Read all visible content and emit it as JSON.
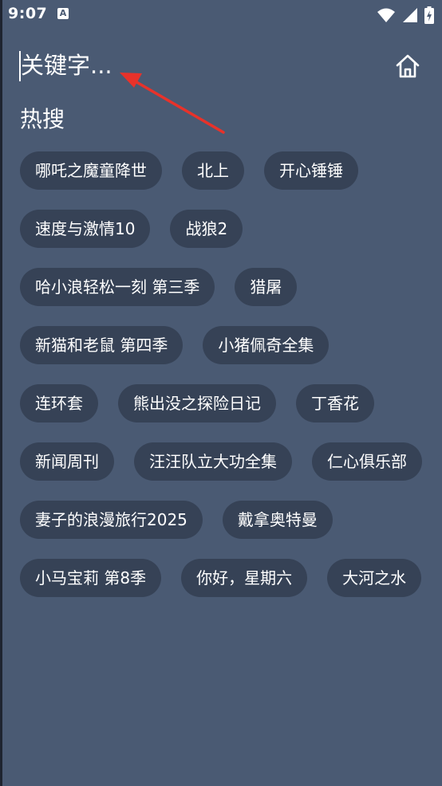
{
  "status_bar": {
    "time": "9:07",
    "notification_letter": "A",
    "icons": [
      "wifi-icon",
      "signal-icon",
      "battery-charging-icon"
    ]
  },
  "search": {
    "placeholder": "关键字...",
    "value": ""
  },
  "home_icon": "home-icon",
  "hot_search": {
    "title": "热搜",
    "items": [
      "哪吒之魔童降世",
      "北上",
      "开心锤锤",
      "速度与激情10",
      "战狼2",
      "哈小浪轻松一刻 第三季",
      "猎屠",
      "新猫和老鼠 第四季",
      "小猪佩奇全集",
      "连环套",
      "熊出没之探险日记",
      "丁香花",
      "新闻周刊",
      "汪汪队立大功全集",
      "仁心俱乐部",
      "妻子的浪漫旅行2025",
      "戴拿奥特曼",
      "小马宝莉 第8季",
      "你好，星期六",
      "大河之水"
    ]
  },
  "colors": {
    "background": "#4a5a73",
    "chip": "#364256",
    "text": "#ffffff",
    "annotation_arrow": "#e8322a"
  }
}
